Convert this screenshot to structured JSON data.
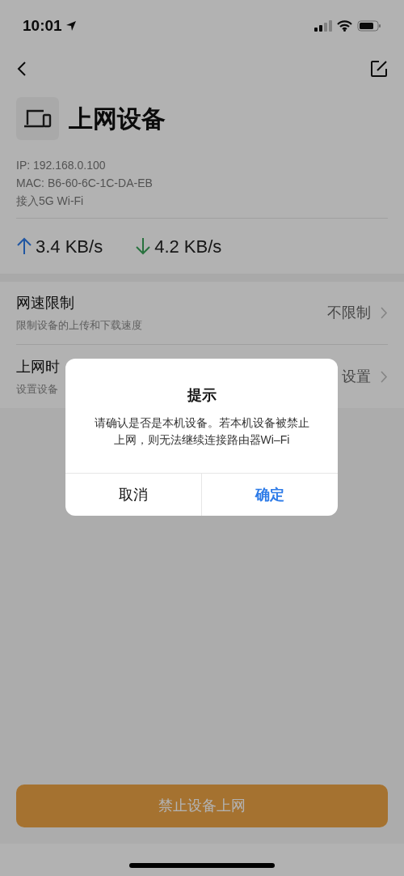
{
  "status_bar": {
    "time": "10:01"
  },
  "device": {
    "title": "上网设备",
    "info": [
      "IP: 192.168.0.100",
      "MAC: B6-60-6C-1C-DA-EB",
      "接入5G Wi-Fi"
    ]
  },
  "speeds": [
    {
      "kind": "upload",
      "value": "3.4 KB/s"
    },
    {
      "kind": "download",
      "value": "4.2 KB/s"
    }
  ],
  "settings": [
    {
      "title": "网速限制",
      "subtitle": "限制设备的上传和下载速度",
      "value": "不限制"
    },
    {
      "title": "上网时",
      "subtitle": "设置设备",
      "value": "设置"
    }
  ],
  "dialog": {
    "title": "提示",
    "message": "请确认是否是本机设备。若本机设备被禁止上网，则无法继续连接路由器Wi–Fi",
    "buttons": [
      {
        "label": "取消",
        "kind": "cancel"
      },
      {
        "label": "确定",
        "kind": "confirm"
      }
    ]
  },
  "action_button": "禁止设备上网"
}
